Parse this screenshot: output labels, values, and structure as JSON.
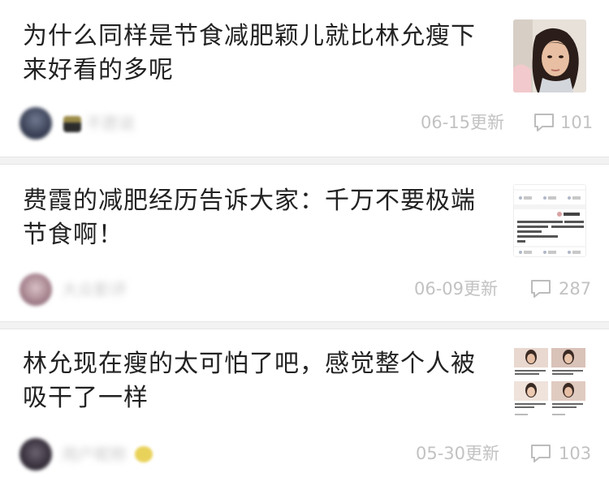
{
  "feed": {
    "items": [
      {
        "title": "为什么同样是节食减肥颖儿就比林允瘦下来好看的多呢",
        "author": "不愿说",
        "date": "06-15更新",
        "comments": "101",
        "thumbnail_icon": "photo-woman-portrait"
      },
      {
        "title": "费霞的减肥经历告诉大家：千万不要极端节食啊！",
        "author": "大众影评",
        "date": "06-09更新",
        "comments": "287",
        "thumbnail_icon": "screenshot-social-post"
      },
      {
        "title": "林允现在瘦的太可怕了吧，感觉整个人被吸干了一样",
        "author": "用户昵称",
        "date": "05-30更新",
        "comments": "103",
        "thumbnail_icon": "photo-grid-collage"
      }
    ]
  },
  "colors": {
    "title": "#222222",
    "meta": "#c2c2c2",
    "divider": "#f2f2f2"
  }
}
